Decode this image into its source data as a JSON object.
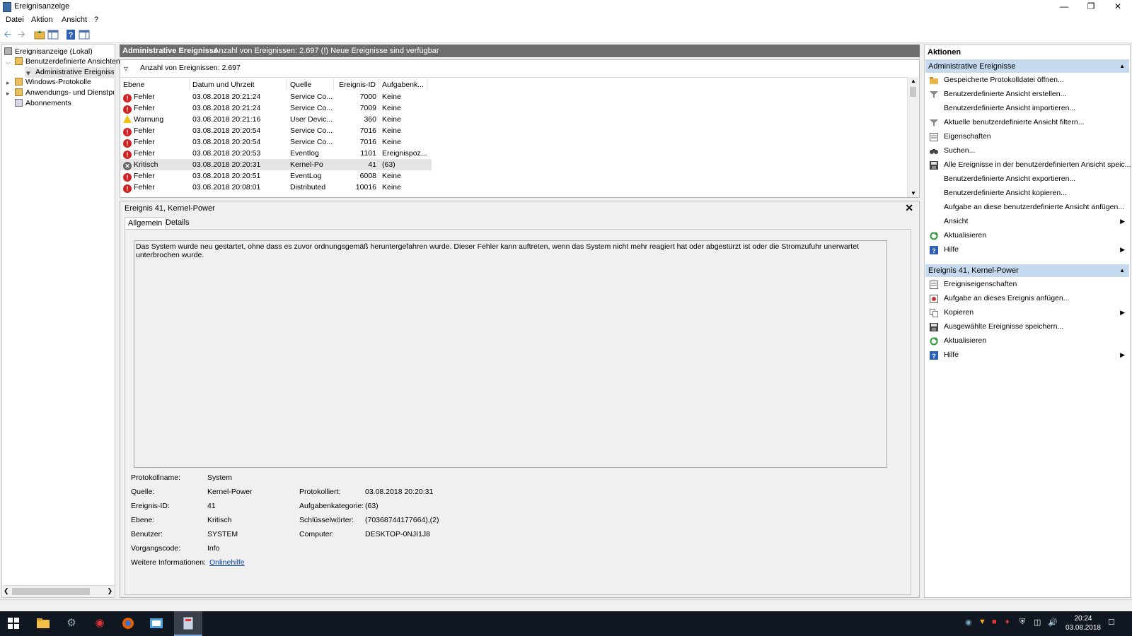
{
  "window": {
    "title": "Ereignisanzeige"
  },
  "menu": {
    "items": [
      "Datei",
      "Aktion",
      "Ansicht",
      "?"
    ]
  },
  "tree": {
    "items": [
      {
        "label": "Ereignisanzeige (Lokal)"
      },
      {
        "label": "Benutzerdefinierte Ansichten"
      },
      {
        "label": "Administrative Ereignisse"
      },
      {
        "label": "Windows-Protokolle"
      },
      {
        "label": "Anwendungs- und Dienstprotokolle"
      },
      {
        "label": "Abonnements"
      }
    ]
  },
  "center": {
    "header_title": "Administrative Ereignisse",
    "header_info": "Anzahl von Ereignissen: 2.697 (!) Neue Ereignisse sind verfügbar",
    "filter_text": "Anzahl von Ereignissen: 2.697",
    "columns": [
      "Ebene",
      "Datum und Uhrzeit",
      "Quelle",
      "Ereignis-ID",
      "Aufgabenk..."
    ],
    "rows": [
      {
        "level": "Fehler",
        "date": "03.08.2018 20:21:24",
        "source": "Service Co...",
        "id": "7000",
        "task": "Keine",
        "kind": "err"
      },
      {
        "level": "Fehler",
        "date": "03.08.2018 20:21:24",
        "source": "Service Co...",
        "id": "7009",
        "task": "Keine",
        "kind": "err"
      },
      {
        "level": "Warnung",
        "date": "03.08.2018 20:21:16",
        "source": "User Devic...",
        "id": "360",
        "task": "Keine",
        "kind": "warn"
      },
      {
        "level": "Fehler",
        "date": "03.08.2018 20:20:54",
        "source": "Service Co...",
        "id": "7016",
        "task": "Keine",
        "kind": "err"
      },
      {
        "level": "Fehler",
        "date": "03.08.2018 20:20:54",
        "source": "Service Co...",
        "id": "7016",
        "task": "Keine",
        "kind": "err"
      },
      {
        "level": "Fehler",
        "date": "03.08.2018 20:20:53",
        "source": "Eventlog",
        "id": "1101",
        "task": "Ereignispoz...",
        "kind": "err"
      },
      {
        "level": "Kritisch",
        "date": "03.08.2018 20:20:31",
        "source": "Kernel-Po",
        "id": "41",
        "task": "(63)",
        "kind": "crit"
      },
      {
        "level": "Fehler",
        "date": "03.08.2018 20:20:51",
        "source": "EventLog",
        "id": "6008",
        "task": "Keine",
        "kind": "err"
      },
      {
        "level": "Fehler",
        "date": "03.08.2018 20:08:01",
        "source": "Distributed",
        "id": "10016",
        "task": "Keine",
        "kind": "err"
      }
    ]
  },
  "detail": {
    "title": "Ereignis 41, Kernel-Power",
    "tabs": [
      "Allgemein",
      "Details"
    ],
    "description": "Das System wurde neu gestartet, ohne dass es zuvor ordnungsgemäß heruntergefahren wurde. Dieser Fehler kann auftreten, wenn das System nicht mehr reagiert hat oder abgestürzt ist oder die Stromzufuhr unerwartet unterbrochen wurde.",
    "fields": {
      "protokollname_label": "Protokollname:",
      "protokollname": "System",
      "quelle_label": "Quelle:",
      "quelle": "Kernel-Power",
      "protokolliert_label": "Protokolliert:",
      "protokolliert": "03.08.2018 20:20:31",
      "id_label": "Ereignis-ID:",
      "id": "41",
      "kategorie_label": "Aufgabenkategorie:",
      "kategorie": "(63)",
      "ebene_label": "Ebene:",
      "ebene": "Kritisch",
      "schluessel_label": "Schlüsselwörter:",
      "schluessel": "(70368744177664),(2)",
      "benutzer_label": "Benutzer:",
      "benutzer": "SYSTEM",
      "computer_label": "Computer:",
      "computer": "DESKTOP-0NJI1J8",
      "vorgang_label": "Vorgangscode:",
      "vorgang": "Info",
      "info_label": "Weitere Informationen:",
      "info_link": "Onlinehilfe"
    }
  },
  "actions": {
    "title": "Aktionen",
    "section1": "Administrative Ereignisse",
    "items1": [
      {
        "label": "Gespeicherte Protokolldatei öffnen...",
        "icon": "folder-open-icon"
      },
      {
        "label": "Benutzerdefinierte Ansicht erstellen...",
        "icon": "filter-icon"
      },
      {
        "label": "Benutzerdefinierte Ansicht importieren...",
        "icon": ""
      },
      {
        "label": "Aktuelle benutzerdefinierte Ansicht filtern...",
        "icon": "filter-icon"
      },
      {
        "label": "Eigenschaften",
        "icon": "properties-icon"
      },
      {
        "label": "Suchen...",
        "icon": "binoculars-icon"
      },
      {
        "label": "Alle Ereignisse in der benutzerdefinierten Ansicht speic...",
        "icon": "save-icon"
      },
      {
        "label": "Benutzerdefinierte Ansicht exportieren...",
        "icon": ""
      },
      {
        "label": "Benutzerdefinierte Ansicht kopieren...",
        "icon": ""
      },
      {
        "label": "Aufgabe an diese benutzerdefinierte Ansicht anfügen...",
        "icon": ""
      },
      {
        "label": "Ansicht",
        "icon": "",
        "submenu": true
      },
      {
        "label": "Aktualisieren",
        "icon": "refresh-icon"
      },
      {
        "label": "Hilfe",
        "icon": "help-icon",
        "submenu": true
      }
    ],
    "section2": "Ereignis 41, Kernel-Power",
    "items2": [
      {
        "label": "Ereigniseigenschaften",
        "icon": "properties-icon"
      },
      {
        "label": "Aufgabe an dieses Ereignis anfügen...",
        "icon": "task-icon"
      },
      {
        "label": "Kopieren",
        "icon": "copy-icon",
        "submenu": true
      },
      {
        "label": "Ausgewählte Ereignisse speichern...",
        "icon": "save-icon"
      },
      {
        "label": "Aktualisieren",
        "icon": "refresh-icon"
      },
      {
        "label": "Hilfe",
        "icon": "help-icon",
        "submenu": true
      }
    ]
  },
  "taskbar": {
    "time": "20:24",
    "date": "03.08.2018"
  },
  "colors": {
    "error": "#d42020",
    "warning": "#f1c40f",
    "section": "#c5d9ef",
    "header": "#6d6d6d"
  }
}
